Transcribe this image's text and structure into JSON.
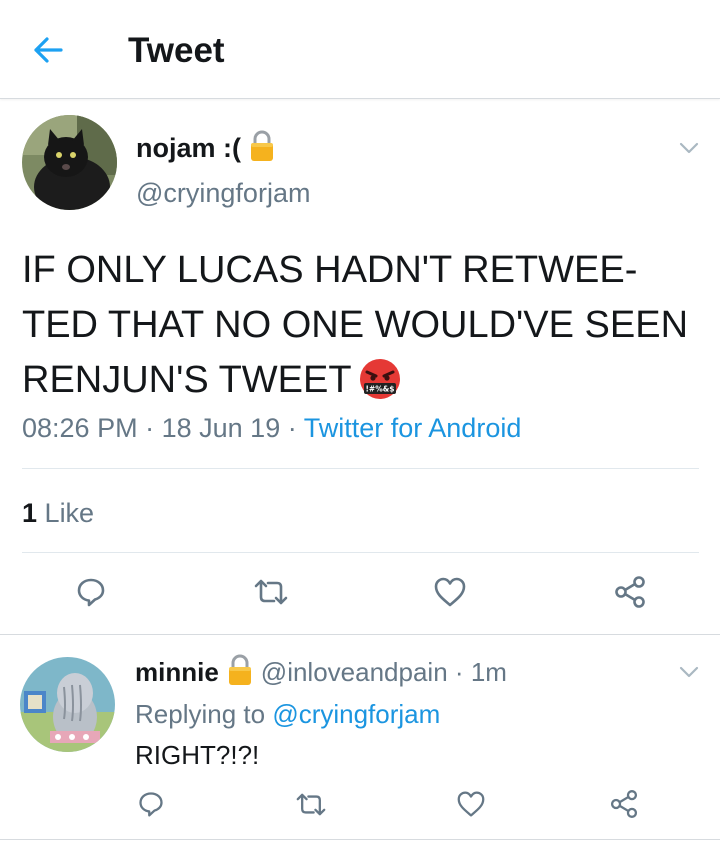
{
  "header": {
    "title": "Tweet",
    "back_icon": "arrow-left-icon"
  },
  "tweet": {
    "display_name": "nojam :(",
    "handle": "@cryingforjam",
    "text": "IF ONLY LUCAS HADN'T RETWEE-\nTED THAT NO ONE WOULD'VE SEEN\nRENJUN'S TWEET",
    "emoji": "swearing-face-emoji",
    "time": "08:26 PM",
    "date": "18 Jun 19",
    "source": "Twitter for Android",
    "likes": {
      "count": "1",
      "label": "Like"
    }
  },
  "reply": {
    "display_name": "minnie",
    "handle": "@inloveandpain",
    "age": "1m",
    "replying_prefix": "Replying to",
    "replying_to": "@cryingforjam",
    "text": "RIGHT?!?!"
  },
  "separator": "·",
  "colors": {
    "accent": "#1b95e0",
    "muted": "#657786",
    "text": "#14171a",
    "border": "#e1e8ed"
  }
}
